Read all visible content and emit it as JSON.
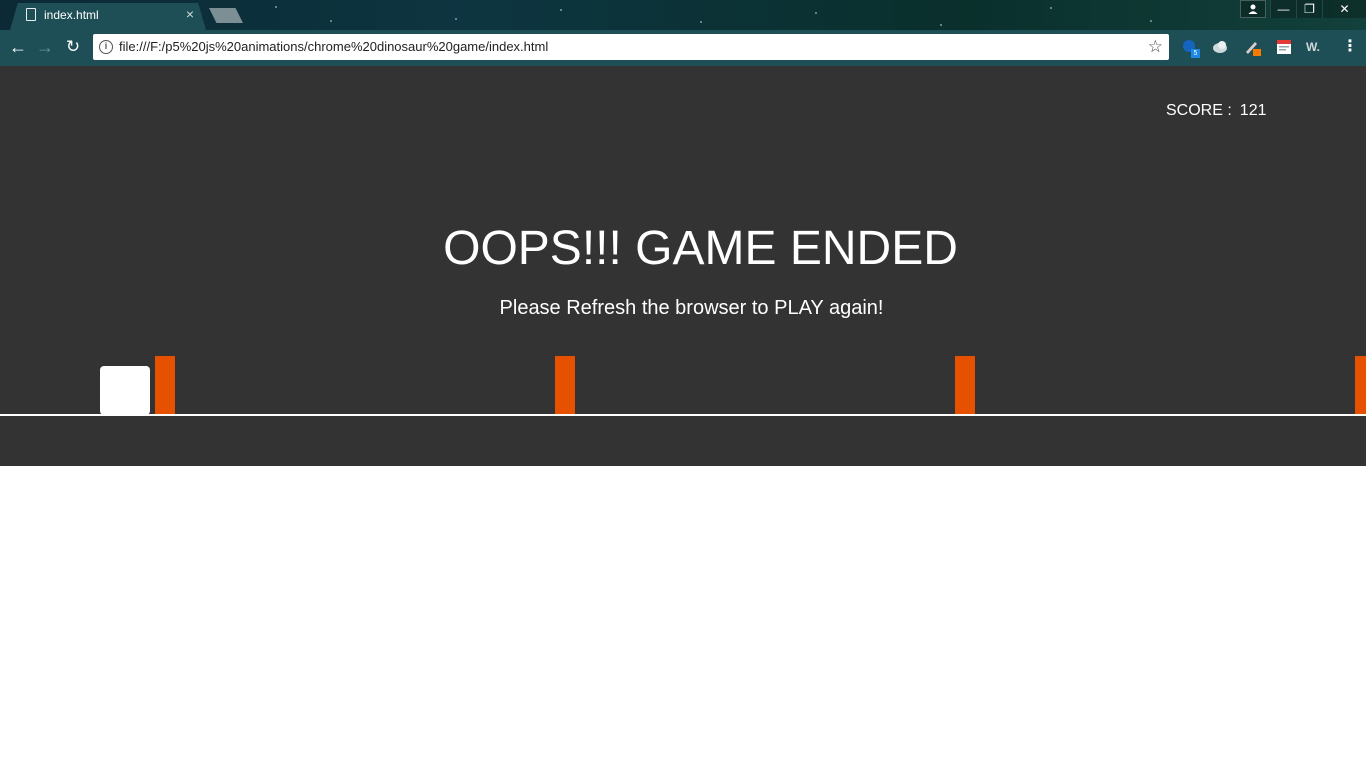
{
  "browser": {
    "tab": {
      "title": "index.html",
      "close_glyph": "×"
    },
    "window_controls": {
      "minimize_glyph": "—",
      "maximize_glyph": "❐",
      "close_glyph": "✕"
    },
    "toolbar": {
      "back_glyph": "←",
      "forward_glyph": "→",
      "reload_glyph": "↻",
      "info_glyph": "i",
      "url": "file:///F:/p5%20js%20animations/chrome%20dinosaur%20game/index.html",
      "bookmark_glyph": "☆",
      "menu_glyph": "⋮"
    },
    "extensions": [
      {
        "icon": "extension-blue-icon",
        "badge": "5",
        "color": "#1e88e5"
      },
      {
        "icon": "extension-cloud-icon",
        "badge": "",
        "color": "#cfd8dc"
      },
      {
        "icon": "extension-pen-icon",
        "badge": "",
        "color": "#f57c00"
      },
      {
        "icon": "extension-notes-icon",
        "badge": "",
        "color": "#ffffff"
      },
      {
        "icon": "extension-w-icon",
        "badge": "",
        "color": "#cfd8dc"
      }
    ],
    "extension_w_text": "W."
  },
  "game": {
    "background_color": "#333333",
    "obstacle_color": "#e65100",
    "score": {
      "label": "SCORE :",
      "value": "121"
    },
    "gameover_title": "OOPS!!! GAME ENDED",
    "gameover_subtitle": "Please Refresh the browser to PLAY again!",
    "obstacle_count": 4
  }
}
